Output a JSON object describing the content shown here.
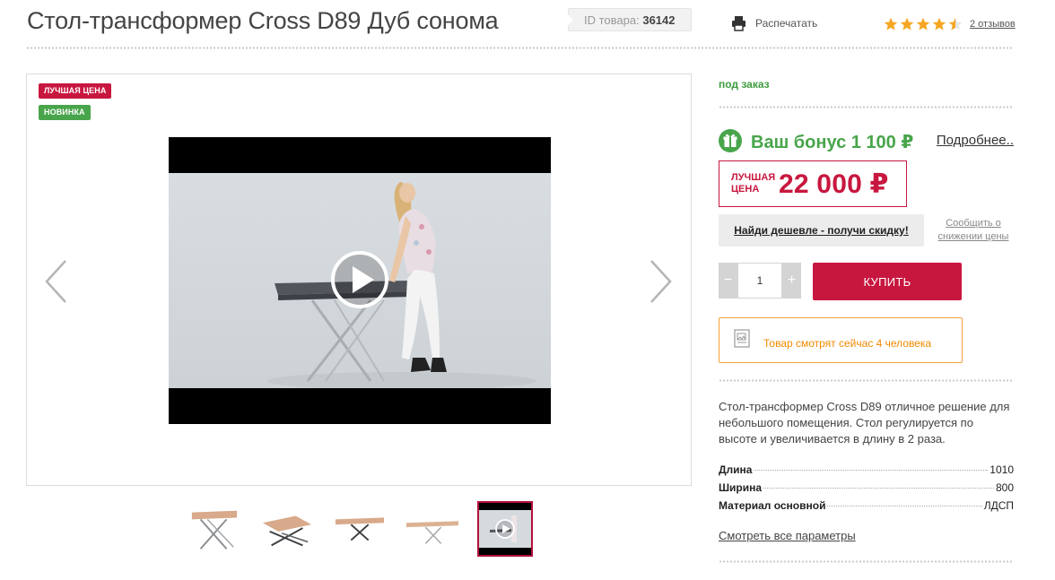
{
  "product": {
    "title": "Стол-трансформер Cross D89 Дуб сонома",
    "id_label": "ID товара:",
    "id_value": "36142"
  },
  "header": {
    "print_label": "Распечатать",
    "rating": 4.5,
    "reviews_label": "2 отзывов",
    "star_color": "#f5a623"
  },
  "gallery": {
    "tags": [
      {
        "label": "ЛУЧШАЯ ЦЕНА",
        "color": "#c8173f"
      },
      {
        "label": "НОВИНКА",
        "color": "#48a54b"
      }
    ],
    "thumbnails": [
      "table-photo-1",
      "table-photo-2",
      "table-photo-3",
      "table-photo-4",
      "video-thumbnail"
    ],
    "active_thumbnail": 4
  },
  "buy": {
    "status": "под заказ",
    "bonus_text": "Ваш бонус 1 100 ₽",
    "more_link": "Подробнее..",
    "price_label_line1": "ЛУЧШАЯ",
    "price_label_line2": "ЦЕНА",
    "price": "22 000 ₽",
    "cheaper_button": "Найди дешевле - получи скидку!",
    "notify_link": "Сообщить о снижении цены",
    "qty_minus": "−",
    "qty_plus": "+",
    "qty_value": "1",
    "buy_button": "КУПИТЬ",
    "watchers_text": "Товар смотрят сейчас 4 человека",
    "accent_color": "#c8173f",
    "bonus_color": "#48a54b"
  },
  "description": "Стол-трансформер Cross D89 отличное решение для небольшого помещения. Стол регулируется по высоте и увеличивается в длину в 2 раза.",
  "specs": [
    {
      "name": "Длина",
      "value": "1010"
    },
    {
      "name": "Ширина",
      "value": "800"
    },
    {
      "name": "Материал основной",
      "value": "ЛДСП"
    }
  ],
  "all_params_link": "Смотреть все параметры"
}
